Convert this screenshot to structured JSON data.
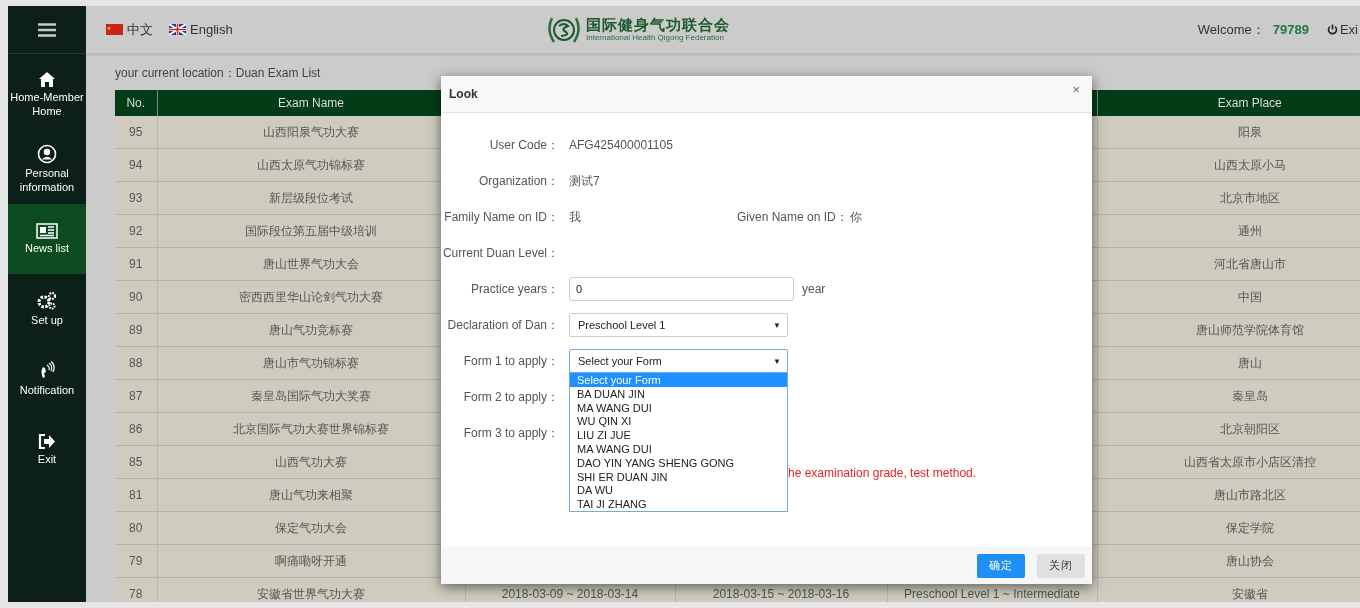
{
  "sidebar": {
    "items": [
      {
        "label": "Home-Member Home",
        "selected": false
      },
      {
        "label": "Personal information",
        "selected": false
      },
      {
        "label": "News list",
        "selected": true
      },
      {
        "label": "Set up",
        "selected": false
      },
      {
        "label": "Notification",
        "selected": false
      },
      {
        "label": "Exit",
        "selected": false
      }
    ]
  },
  "header": {
    "languages": [
      {
        "label": "中文"
      },
      {
        "label": "English"
      }
    ],
    "logo": {
      "name": "国际健身气功联合会",
      "subtitle": "International Health Qigong Federation"
    },
    "welcome_label": "Welcome：",
    "user": "79789",
    "exit": "Exi"
  },
  "location": "your current location：Duan Exam List",
  "table": {
    "columns": [
      {
        "label": "No."
      },
      {
        "label": "Exam Name"
      },
      {},
      {},
      {},
      {
        "label": "Exam Place"
      }
    ],
    "rows": [
      {
        "cells": [
          "95",
          "山西阳泉气功大赛",
          "",
          "",
          "",
          "阳泉"
        ]
      },
      {
        "cells": [
          "94",
          "山西太原气功锦标赛",
          "",
          "",
          "",
          "山西太原小马"
        ]
      },
      {
        "cells": [
          "93",
          "新层级段位考试",
          "",
          "",
          "",
          "北京市地区"
        ]
      },
      {
        "cells": [
          "92",
          "国际段位第五届中级培训",
          "",
          "",
          "",
          "通州"
        ]
      },
      {
        "cells": [
          "91",
          "唐山世界气功大会",
          "",
          "",
          "",
          "河北省唐山市"
        ]
      },
      {
        "cells": [
          "90",
          "密西西里华山论剑气功大赛",
          "",
          "",
          "",
          "中国"
        ]
      },
      {
        "cells": [
          "89",
          "唐山气功竞标赛",
          "",
          "",
          "",
          "唐山师范学院体育馆"
        ]
      },
      {
        "cells": [
          "88",
          "唐山市气功锦标赛",
          "",
          "",
          "",
          "唐山"
        ]
      },
      {
        "cells": [
          "87",
          "秦皇岛国际气功大奖赛",
          "",
          "",
          "",
          "秦皇岛"
        ]
      },
      {
        "cells": [
          "86",
          "北京国际气功大赛世界锦标赛",
          "",
          "",
          "",
          "北京朝阳区"
        ]
      },
      {
        "cells": [
          "85",
          "山西气功大赛",
          "",
          "",
          "",
          "山西省太原市小店区清控"
        ]
      },
      {
        "cells": [
          "81",
          "唐山气功来相聚",
          "",
          "",
          "",
          "唐山市路北区"
        ]
      },
      {
        "cells": [
          "80",
          "保定气功大会",
          "",
          "",
          "",
          "保定学院"
        ]
      },
      {
        "cells": [
          "79",
          "啊痛嘞呀开通",
          "",
          "",
          "",
          "唐山协会"
        ]
      },
      {
        "cells": [
          "78",
          "安徽省世界气功大赛",
          "2018-03-09 ~ 2018-03-14",
          "2018-03-15 ~ 2018-03-16",
          "Preschool Level 1 ~ Intermediate",
          "安徽省"
        ]
      }
    ]
  },
  "dialog": {
    "title": "Look",
    "close": "×",
    "fields": [
      {
        "kind": "text",
        "label": "User Code：",
        "value": "AFG425400001105"
      },
      {
        "kind": "text",
        "label": "Organization：",
        "value": "测试7"
      },
      {
        "kind": "pair",
        "label": "Family Name on ID：",
        "value": "我",
        "label_2": "Given Name on ID：",
        "value_2": "你"
      },
      {
        "kind": "text",
        "label": "Current Duan Level："
      },
      {
        "kind": "input",
        "label": "Practice years：",
        "value": "0",
        "unit": "year"
      },
      {
        "kind": "select",
        "label": "Declaration of Dan：",
        "value": "Preschool Level 1",
        "arrow": "▼"
      },
      {
        "kind": "select",
        "label": "Form 1 to apply：",
        "value": "Select your Form",
        "arrow": "▼",
        "focused": true
      },
      {
        "kind": "blank",
        "label": "Form 2 to apply："
      },
      {
        "kind": "blank",
        "label": "Form 3 to apply："
      }
    ],
    "note": "he examination grade, test method.",
    "dropdown": [
      {
        "label": "Select your Form",
        "selected": true
      },
      {
        "label": "BA DUAN JIN",
        "selected": false
      },
      {
        "label": "MA WANG DUI",
        "selected": false
      },
      {
        "label": "WU QIN XI",
        "selected": false
      },
      {
        "label": "LIU ZI JUE",
        "selected": false
      },
      {
        "label": "MA WANG DUI",
        "selected": false
      },
      {
        "label": "DAO YIN YANG SHENG GONG",
        "selected": false
      },
      {
        "label": "SHI ER DUAN JIN",
        "selected": false
      },
      {
        "label": "DA WU",
        "selected": false
      },
      {
        "label": "TAI JI ZHANG",
        "selected": false
      }
    ],
    "buttons": [
      {
        "label": "确定",
        "kind": "primary"
      },
      {
        "label": "关闭",
        "kind": "default"
      }
    ]
  }
}
